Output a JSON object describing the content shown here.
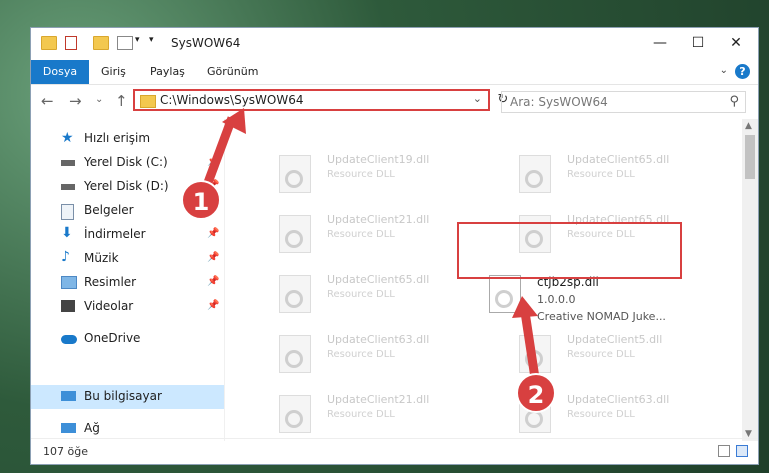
{
  "window": {
    "title": "SysWOW64"
  },
  "ribbon": {
    "tabs": [
      "Dosya",
      "Giriş",
      "Paylaş",
      "Görünüm"
    ]
  },
  "address": {
    "path": "C:\\Windows\\SysWOW64"
  },
  "search": {
    "placeholder": "Ara: SysWOW64"
  },
  "sidebar": {
    "items": [
      {
        "label": "Hızlı erişim",
        "icon": "star-icon"
      },
      {
        "label": "Yerel Disk (C:)",
        "icon": "drive-icon"
      },
      {
        "label": "Yerel Disk (D:)",
        "icon": "drive-icon"
      },
      {
        "label": "Belgeler",
        "icon": "documents-icon"
      },
      {
        "label": "İndirmeler",
        "icon": "download-icon"
      },
      {
        "label": "Müzik",
        "icon": "music-icon"
      },
      {
        "label": "Resimler",
        "icon": "pictures-icon"
      },
      {
        "label": "Videolar",
        "icon": "videos-icon"
      },
      {
        "label": "OneDrive",
        "icon": "cloud-icon"
      },
      {
        "label": "Bu bilgisayar",
        "icon": "computer-icon"
      },
      {
        "label": "Ağ",
        "icon": "network-icon"
      }
    ]
  },
  "files": [
    {
      "name": "UpdateClient19.dll",
      "desc": "Resource DLL"
    },
    {
      "name": "UpdateClient65.dll",
      "desc": "Resource DLL"
    },
    {
      "name": "UpdateClient21.dll",
      "desc": "Resource DLL"
    },
    {
      "name": "UpdateClient65.dll",
      "desc": "Resource DLL"
    },
    {
      "name": "UpdateClient65.dll",
      "desc": "Resource DLL"
    },
    {
      "name": "ctjb2sp.dll",
      "desc": "1.0.0.0",
      "desc2": "Creative NOMAD Juke..."
    },
    {
      "name": "UpdateClient63.dll",
      "desc": "Resource DLL"
    },
    {
      "name": "UpdateClient5.dll",
      "desc": "Resource DLL"
    },
    {
      "name": "UpdateClient21.dll",
      "desc": "Resource DLL"
    },
    {
      "name": "UpdateClient63.dll",
      "desc": "Resource DLL"
    }
  ],
  "status": {
    "count": "107 öğe"
  },
  "callouts": [
    "1",
    "2"
  ],
  "colors": {
    "accent": "#1979ca",
    "highlight": "#d84040",
    "selection": "#cce8ff"
  }
}
